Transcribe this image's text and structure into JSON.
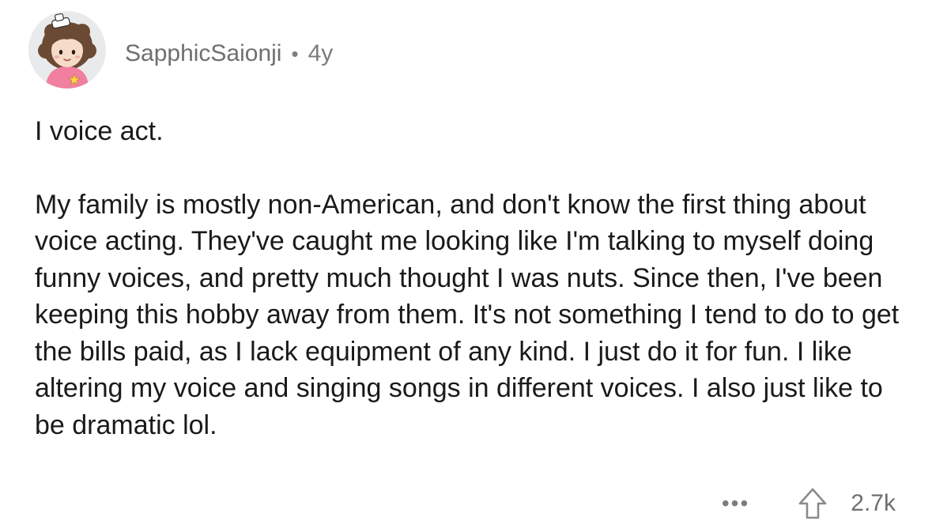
{
  "comment": {
    "username": "SapphicSaionji",
    "separator": "•",
    "age": "4y",
    "paragraphs": [
      "I voice act.",
      "My family is mostly non-American, and don't know the first thing about voice acting. They've caught me looking like I'm talking to myself doing funny voices, and pretty much thought I was nuts. Since then, I've been keeping this hobby away from them. It's not something I tend to do to get the bills paid, as I lack equipment of any kind. I just do it for fun. I like altering my voice and singing songs in different voices. I also just like to be dramatic lol."
    ],
    "more_label": "•••",
    "score": "2.7k",
    "icons": {
      "avatar": "avatar-icon",
      "more": "more-options-icon",
      "upvote": "upvote-arrow-icon"
    },
    "colors": {
      "text": "#1a1a1b",
      "meta": "#7c7c7c",
      "avatar_bg": "#e9eaeb",
      "avatar_shirt": "#f07fa0"
    }
  }
}
